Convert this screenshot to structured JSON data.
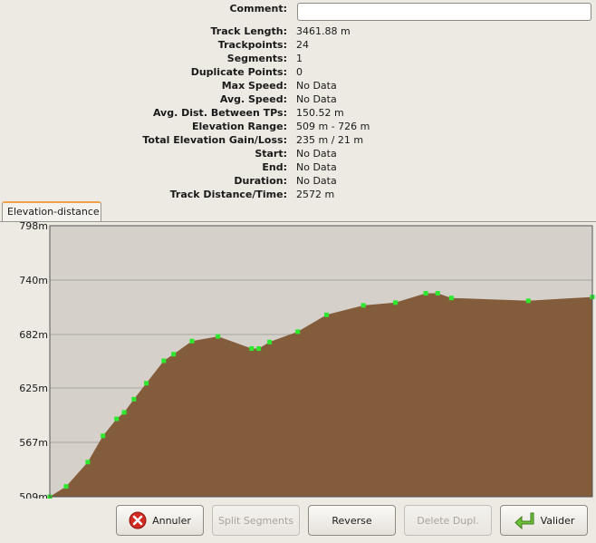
{
  "info": {
    "comment_label": "Comment:",
    "comment_value": "",
    "rows": [
      {
        "label": "Track Length:",
        "value": "3461.88 m"
      },
      {
        "label": "Trackpoints:",
        "value": "24"
      },
      {
        "label": "Segments:",
        "value": "1"
      },
      {
        "label": "Duplicate Points:",
        "value": "0"
      },
      {
        "label": "Max Speed:",
        "value": "No Data"
      },
      {
        "label": "Avg. Speed:",
        "value": "No Data"
      },
      {
        "label": "Avg. Dist. Between TPs:",
        "value": "150.52 m"
      },
      {
        "label": "Elevation Range:",
        "value": "509 m - 726 m"
      },
      {
        "label": "Total Elevation Gain/Loss:",
        "value": "235 m / 21 m"
      },
      {
        "label": "Start:",
        "value": "No Data"
      },
      {
        "label": "End:",
        "value": "No Data"
      },
      {
        "label": "Duration:",
        "value": "No Data"
      },
      {
        "label": "Track Distance/Time:",
        "value": "2572 m"
      }
    ]
  },
  "tab": {
    "label": "Elevation-distance"
  },
  "chart_data": {
    "type": "area",
    "ylim": [
      509,
      798
    ],
    "xlim": [
      0,
      1
    ],
    "yticks": [
      "798m",
      "740m",
      "682m",
      "625m",
      "567m",
      "509m"
    ],
    "ytick_values": [
      798,
      740,
      682,
      625,
      567,
      509
    ],
    "grid": true,
    "fill_color": "#835c3b",
    "background_color": "#d5d0ca",
    "point_color": "#2ee82e",
    "points": [
      {
        "x": 0.0,
        "y": 509
      },
      {
        "x": 0.03,
        "y": 520
      },
      {
        "x": 0.07,
        "y": 546
      },
      {
        "x": 0.098,
        "y": 574
      },
      {
        "x": 0.123,
        "y": 592
      },
      {
        "x": 0.137,
        "y": 599
      },
      {
        "x": 0.155,
        "y": 613
      },
      {
        "x": 0.178,
        "y": 630
      },
      {
        "x": 0.21,
        "y": 654
      },
      {
        "x": 0.228,
        "y": 661
      },
      {
        "x": 0.262,
        "y": 675
      },
      {
        "x": 0.31,
        "y": 680
      },
      {
        "x": 0.372,
        "y": 667
      },
      {
        "x": 0.385,
        "y": 667
      },
      {
        "x": 0.405,
        "y": 674
      },
      {
        "x": 0.457,
        "y": 685
      },
      {
        "x": 0.51,
        "y": 703
      },
      {
        "x": 0.578,
        "y": 713
      },
      {
        "x": 0.637,
        "y": 716
      },
      {
        "x": 0.693,
        "y": 726
      },
      {
        "x": 0.715,
        "y": 726
      },
      {
        "x": 0.74,
        "y": 721
      },
      {
        "x": 0.882,
        "y": 718
      },
      {
        "x": 1.0,
        "y": 722
      }
    ]
  },
  "buttons": {
    "annuler": "Annuler",
    "split": "Split Segments",
    "reverse": "Reverse",
    "delete": "Delete Dupl.",
    "valider": "Valider"
  }
}
